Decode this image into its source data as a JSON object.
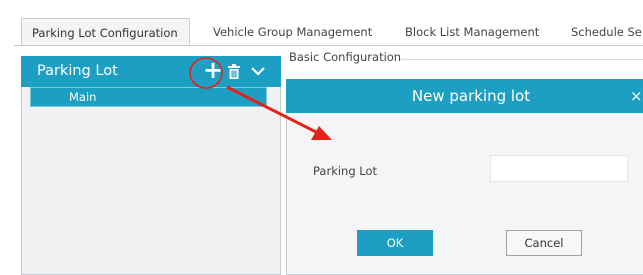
{
  "tabs": [
    {
      "label": "Parking Lot Configuration",
      "active": true
    },
    {
      "label": "Vehicle Group Management",
      "active": false
    },
    {
      "label": "Block List Management",
      "active": false
    },
    {
      "label": "Schedule Se",
      "active": false
    }
  ],
  "left_panel": {
    "title": "Parking Lot",
    "icons": [
      "add-icon",
      "trash-icon",
      "chevron-down-icon"
    ],
    "tree": [
      {
        "label": "Main",
        "selected": true
      }
    ]
  },
  "basic_config_label": "Basic Configuration",
  "dialog": {
    "title": "New parking lot",
    "close_glyph": "×",
    "field_label": "Parking Lot",
    "field_value": "",
    "ok_label": "OK",
    "cancel_label": "Cancel"
  },
  "colors": {
    "accent": "#1d9fc3",
    "annotation": "#e2231a",
    "panel_bg": "#f0f1f2"
  }
}
